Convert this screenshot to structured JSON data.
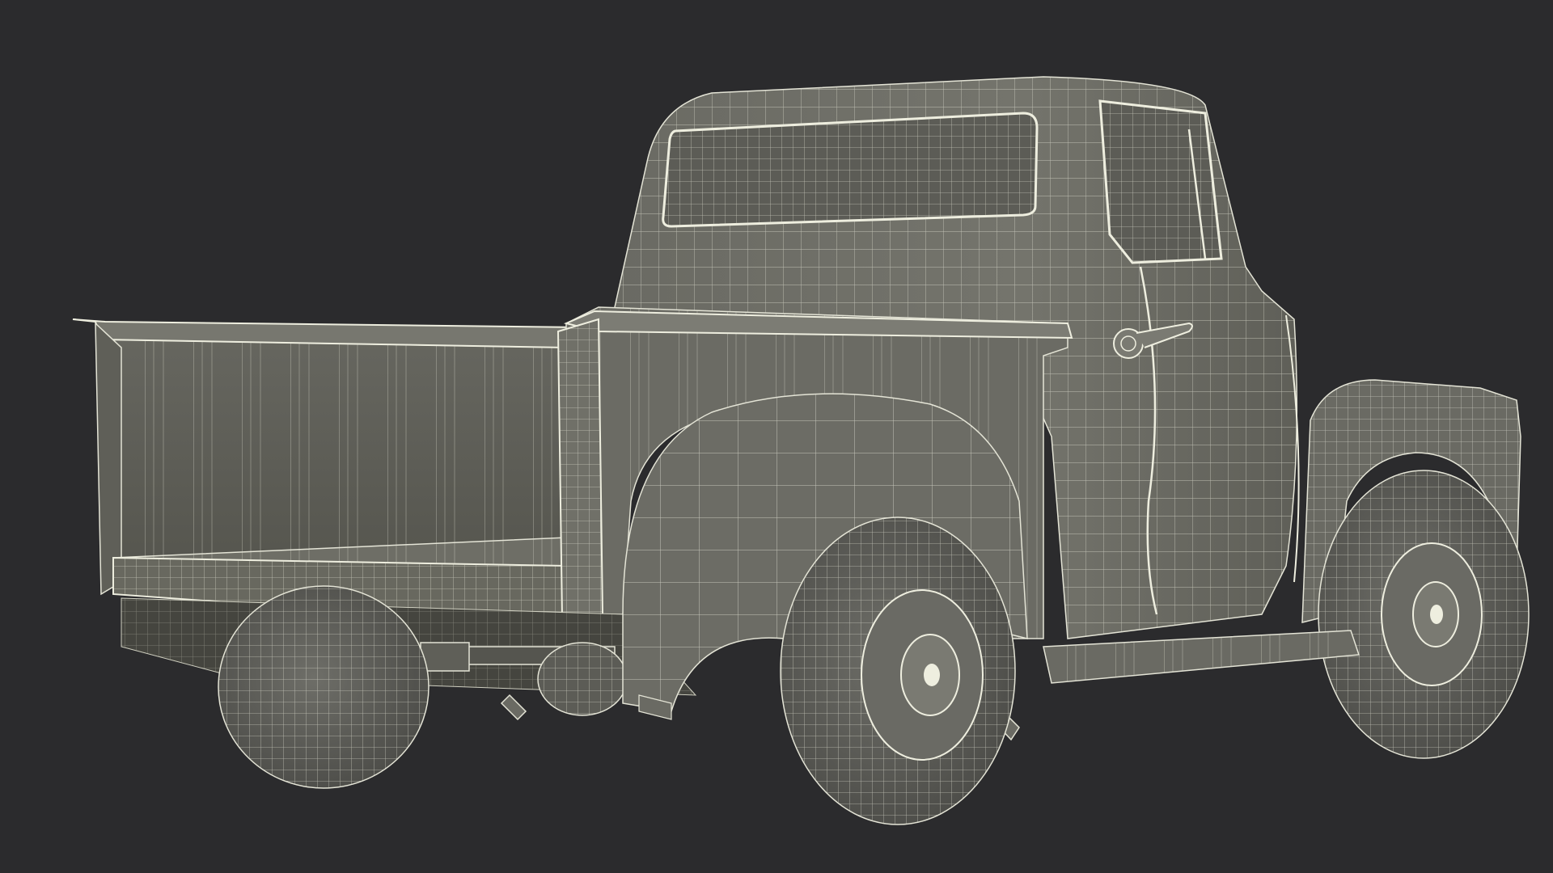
{
  "scene": {
    "background_color": "#2b2b2d",
    "surface_color": "#6e6e68",
    "surface_shadow_color": "#4e4e4a",
    "surface_highlight_color": "#85857d",
    "wire_color": "#e4e4d6",
    "subject": "pickup-truck-wireframe",
    "view": "rear-three-quarter"
  }
}
